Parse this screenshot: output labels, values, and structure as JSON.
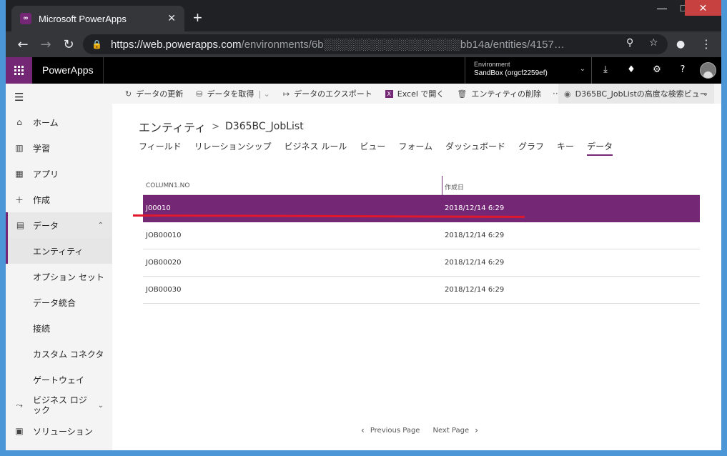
{
  "browser": {
    "tab_title": "Microsoft PowerApps",
    "tab_icon": "powerapps-icon",
    "url_host": "https://web.powerapps.com",
    "url_path": "/environments/6b░░░░░░░░░░░░░░░░░░bb14a/entities/4157…"
  },
  "app": {
    "brand": "PowerApps",
    "environment_label": "Environment",
    "environment_value": "SandBox (orgcf2259ef)"
  },
  "sidebar": {
    "items": [
      {
        "label": "ホーム",
        "icon": "home-icon",
        "glyph": "⌂"
      },
      {
        "label": "学習",
        "icon": "book-icon",
        "glyph": "▥"
      },
      {
        "label": "アプリ",
        "icon": "apps-icon",
        "glyph": "▦"
      },
      {
        "label": "作成",
        "icon": "plus-icon",
        "glyph": "＋"
      },
      {
        "label": "データ",
        "icon": "table-icon",
        "glyph": "▤"
      },
      {
        "label": "エンティティ"
      },
      {
        "label": "オプション セット"
      },
      {
        "label": "データ統合"
      },
      {
        "label": "接続"
      },
      {
        "label": "カスタム コネクタ"
      },
      {
        "label": "ゲートウェイ"
      },
      {
        "label": "ビジネス ロジック",
        "icon": "flow-icon",
        "glyph": "⤳"
      },
      {
        "label": "ソリューション",
        "icon": "solution-icon",
        "glyph": "▣"
      }
    ]
  },
  "commandbar": {
    "refresh": "データの更新",
    "get_data": "データを取得",
    "export": "データのエクスポート",
    "excel": "Excel で開く",
    "delete": "エンティティの削除",
    "more": "···",
    "view_selector": "D365BC_JobListの高度な検索ビュー"
  },
  "breadcrumb": {
    "root": "エンティティ",
    "separator": ">",
    "entity": "D365BC_JobList"
  },
  "tabs": [
    "フィールド",
    "リレーションシップ",
    "ビジネス ルール",
    "ビュー",
    "フォーム",
    "ダッシュボード",
    "グラフ",
    "キー",
    "データ"
  ],
  "table": {
    "columns": [
      "COLUMN1.NO",
      "作成日"
    ],
    "rows": [
      [
        "J00010",
        "2018/12/14 6:29"
      ],
      [
        "JOB00010",
        "2018/12/14 6:29"
      ],
      [
        "JOB00020",
        "2018/12/14 6:29"
      ],
      [
        "JOB00030",
        "2018/12/14 6:29"
      ]
    ]
  },
  "pager": {
    "prev": "Previous Page",
    "next": "Next Page"
  },
  "colors": {
    "accent": "#742774",
    "annotation": "#e0182d"
  }
}
